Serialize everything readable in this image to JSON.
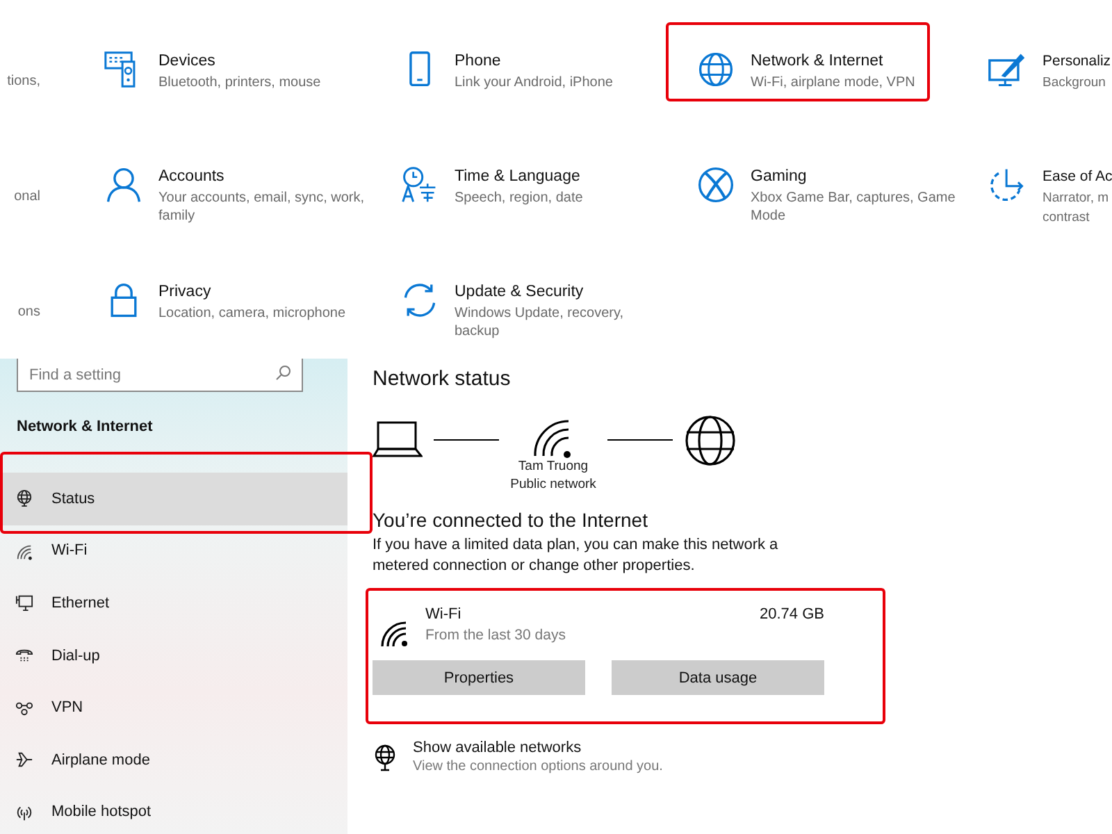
{
  "settings_grid": {
    "tiles": [
      {
        "kind": "cut_left",
        "description": "tions,"
      },
      {
        "kind": "full",
        "title": "Devices",
        "description": "Bluetooth, printers, mouse",
        "highlighted": false
      },
      {
        "kind": "full",
        "title": "Phone",
        "description": "Link your Android, iPhone",
        "highlighted": false
      },
      {
        "kind": "full",
        "title": "Network & Internet",
        "description": "Wi-Fi, airplane mode, VPN",
        "highlighted": true
      },
      {
        "kind": "cut_right",
        "title": "Personaliz",
        "description_lines": [
          "Backgroun"
        ]
      },
      {
        "kind": "cut_left",
        "description": "onal"
      },
      {
        "kind": "full",
        "title": "Accounts",
        "description": "Your accounts, email, sync, work, family",
        "highlighted": false
      },
      {
        "kind": "full",
        "title": "Time & Language",
        "description": "Speech, region, date",
        "highlighted": false
      },
      {
        "kind": "full",
        "title": "Gaming",
        "description": "Xbox Game Bar, captures, Game Mode",
        "highlighted": false
      },
      {
        "kind": "cut_right",
        "title": "Ease of Ac",
        "description_lines": [
          "Narrator, m",
          "contrast"
        ]
      },
      {
        "kind": "cut_left",
        "description": "ons"
      },
      {
        "kind": "full",
        "title": "Privacy",
        "description": "Location, camera, microphone",
        "highlighted": false
      },
      {
        "kind": "full",
        "title": "Update & Security",
        "description": "Windows Update, recovery, backup",
        "highlighted": false
      }
    ]
  },
  "sidebar": {
    "search": {
      "placeholder": "Find a setting"
    },
    "heading": "Network & Internet",
    "items": [
      {
        "label": "Status",
        "selected": true,
        "highlighted": true
      },
      {
        "label": "Wi-Fi",
        "selected": false,
        "highlighted": false
      },
      {
        "label": "Ethernet",
        "selected": false,
        "highlighted": false
      },
      {
        "label": "Dial-up",
        "selected": false,
        "highlighted": false
      },
      {
        "label": "VPN",
        "selected": false,
        "highlighted": false
      },
      {
        "label": "Airplane mode",
        "selected": false,
        "highlighted": false
      },
      {
        "label": "Mobile hotspot",
        "selected": false,
        "highlighted": false
      }
    ]
  },
  "content": {
    "title": "Network status",
    "network_name": "Tam Truong",
    "network_type": "Public network",
    "connected_heading": "You’re connected to the Internet",
    "connected_text": "If you have a limited data plan, you can make this network a metered connection or change other properties.",
    "usage_card": {
      "highlighted": true,
      "name": "Wi-Fi",
      "period": "From the last 30 days",
      "amount": "20.74 GB",
      "buttons": [
        "Properties",
        "Data usage"
      ]
    },
    "show_networks": {
      "title": "Show available networks",
      "description": "View the connection options around you."
    }
  }
}
